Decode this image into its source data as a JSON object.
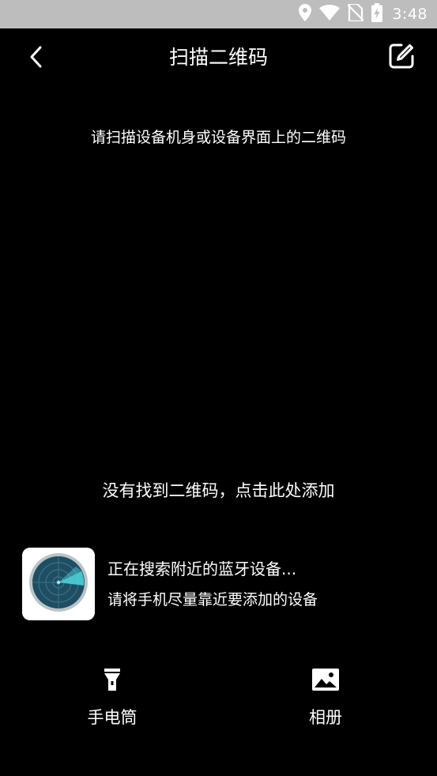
{
  "status_bar": {
    "time": "3:48",
    "icons": [
      "location-icon",
      "wifi-icon",
      "no-sim-icon",
      "battery-charging-icon"
    ]
  },
  "header": {
    "title": "扫描二维码",
    "back_icon": "chevron-left-icon",
    "edit_icon": "edit-icon"
  },
  "scanner": {
    "hint": "请扫描设备机身或设备界面上的二维码",
    "not_found_link": "没有找到二维码，点击此处添加"
  },
  "bluetooth": {
    "title": "正在搜索附近的蓝牙设备...",
    "subtitle": "请将手机尽量靠近要添加的设备",
    "icon": "radar-icon"
  },
  "toolbar": {
    "flashlight_label": "手电筒",
    "flashlight_icon": "flashlight-icon",
    "album_label": "相册",
    "album_icon": "image-icon"
  },
  "colors": {
    "background": "#000000",
    "status_bar": "#bdbdbd",
    "text": "#ffffff",
    "radar_accent": "#4fd8e0",
    "radar_dark": "#1f4e63"
  }
}
